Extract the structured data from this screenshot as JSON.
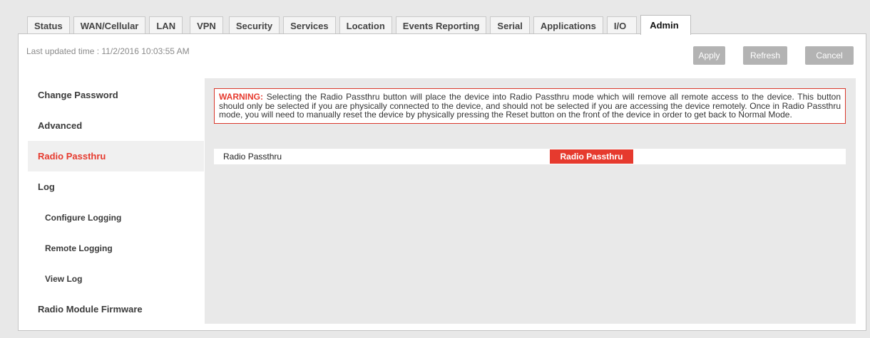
{
  "tabs": [
    {
      "label": "Status"
    },
    {
      "label": "WAN/Cellular"
    },
    {
      "label": "LAN"
    },
    {
      "label": "VPN"
    },
    {
      "label": "Security"
    },
    {
      "label": "Services"
    },
    {
      "label": "Location"
    },
    {
      "label": "Events Reporting"
    },
    {
      "label": "Serial"
    },
    {
      "label": "Applications"
    },
    {
      "label": "I/O"
    },
    {
      "label": "Admin"
    }
  ],
  "header": {
    "last_updated": "Last updated time : 11/2/2016 10:03:55 AM",
    "apply_label": "Apply",
    "refresh_label": "Refresh",
    "cancel_label": "Cancel"
  },
  "sidebar": {
    "items": [
      {
        "label": "Change Password"
      },
      {
        "label": "Advanced"
      },
      {
        "label": "Radio Passthru"
      },
      {
        "label": "Log"
      },
      {
        "label": "Configure Logging"
      },
      {
        "label": "Remote Logging"
      },
      {
        "label": "View Log"
      },
      {
        "label": "Radio Module Firmware"
      }
    ]
  },
  "main": {
    "warning_label": "WARNING:",
    "warning_text": " Selecting the Radio Passthru button will place the device into Radio Passthru mode which will remove all remote access to the device. This button should only be selected if you are physically connected to the device, and should not be selected if you are accessing the device remotely. Once in Radio Passthru mode, you will need to manually reset the device by physically pressing the Reset button on the front of the device in order to get back to Normal Mode.",
    "row_label": "Radio Passthru",
    "button_label": "Radio Passthru"
  },
  "colors": {
    "accent": "#e63a2e",
    "button_disabled": "#b3b3b3"
  }
}
